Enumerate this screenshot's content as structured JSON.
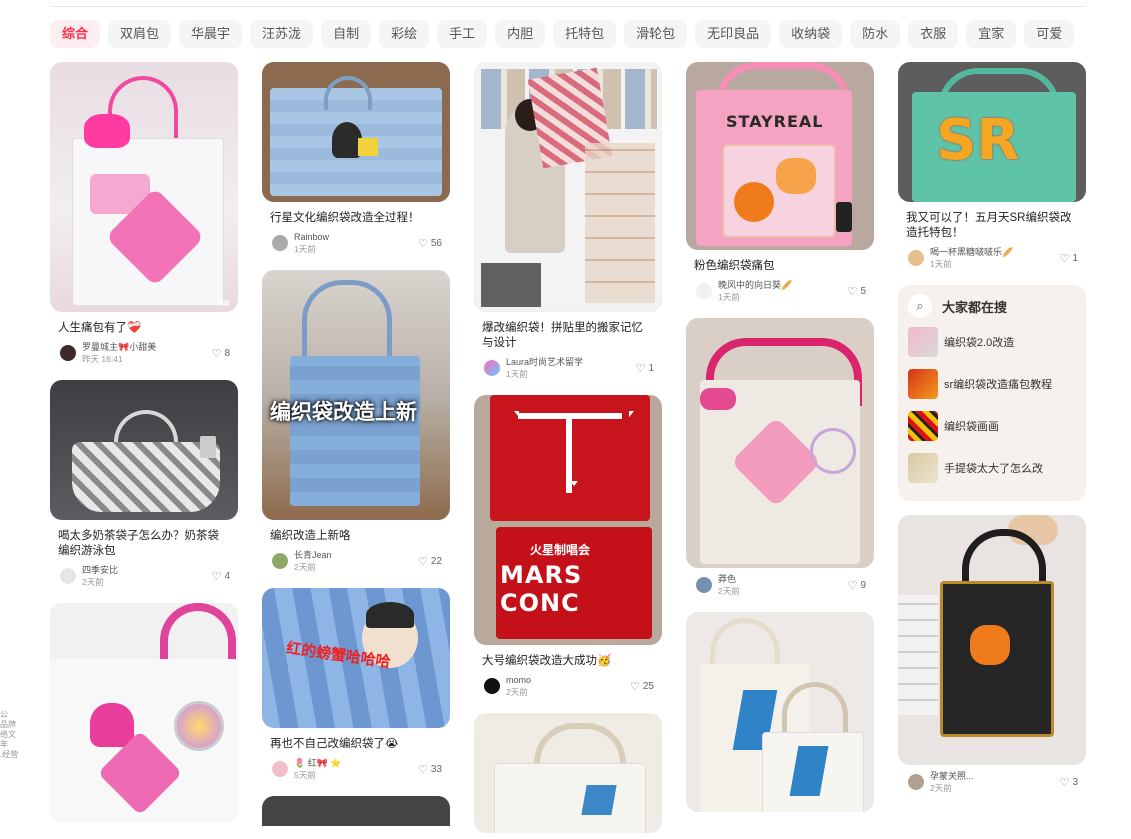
{
  "tabs": [
    "综合",
    "双肩包",
    "华晨宇",
    "汪苏泷",
    "自制",
    "彩绘",
    "手工",
    "内胆",
    "托特包",
    "滑轮包",
    "无印良品",
    "收纳袋",
    "防水",
    "衣服",
    "宜家",
    "可爱"
  ],
  "colors": {
    "accent": "#ff2e4d",
    "tab_bg": "#f5f5f5",
    "panel_bg": "#f6f1ec"
  },
  "cards": {
    "c1": {
      "title": "人生痛包有了❤️‍🩹",
      "author": "罗曼城主🎀小甜美",
      "time": "昨天 16:41",
      "likes": "8"
    },
    "c2": {
      "title": "喝太多奶茶袋子怎么办？奶茶袋编织游泳包",
      "author": "四季安比",
      "time": "2天前",
      "likes": "4"
    },
    "c3": {
      "title": "行星文化编织袋改造全过程！",
      "author": "Rainbow",
      "time": "1天前",
      "likes": "56"
    },
    "c4": {
      "title": "编织改造上新咯",
      "author": "长青Jean",
      "time": "2天前",
      "likes": "22",
      "overlay": "编织袋改造上新"
    },
    "c5": {
      "title": "再也不自己改编织袋了😭",
      "author": "🌷 红🎀 ⭐",
      "time": "5天前",
      "likes": "33",
      "overlay": "红的螃蟹哈哈哈"
    },
    "c6": {
      "title": "爆改编织袋！拼贴里的搬家记忆与设计",
      "author": "Laura时尚艺术留学",
      "time": "1天前",
      "likes": "1"
    },
    "c7": {
      "title": "大号编织袋改造大成功🥳",
      "author": "momo",
      "time": "2天前",
      "likes": "25",
      "overlay": "MARS CONC",
      "overlay2": "火星制唱会"
    },
    "c8": {
      "title": "粉色编织袋痛包",
      "author": "晚风中的向日葵🥖",
      "time": "1天前",
      "likes": "5",
      "overlay": "STAYREAL"
    },
    "c9": {
      "title": "",
      "author": "莽色",
      "time": "2天前",
      "likes": "9"
    },
    "c10": {
      "title": "我又可以了！五月天SR编织袋改造托特包！",
      "author": "喝一杯黑糖啵啵乐🥖",
      "time": "1天前",
      "likes": "1",
      "overlay": "SR"
    },
    "c11": {
      "title": "",
      "author": "孕蒙关照...",
      "time": "2天前",
      "likes": "3"
    }
  },
  "search_panel": {
    "title": "大家都在搜",
    "items": [
      "编织袋2.0改造",
      "sr编织袋改造痛包教程",
      "编织袋画画",
      "手提袋太大了怎么改"
    ]
  },
  "sidecut": [
    "公",
    "品牌",
    "络文",
    "年",
    "",
    ",经营"
  ],
  "icons": {
    "heart": "heart-icon",
    "search": "search-icon"
  }
}
